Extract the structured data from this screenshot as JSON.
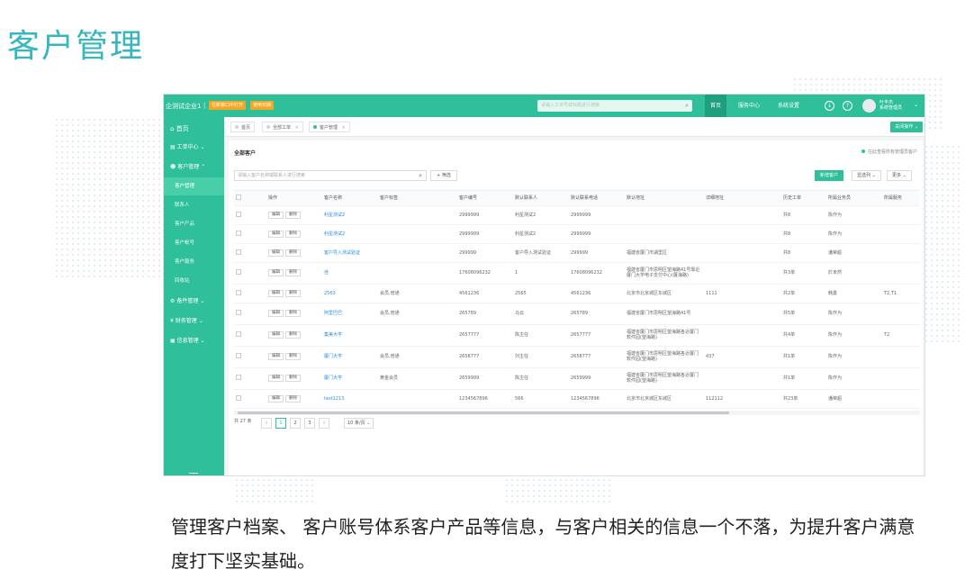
{
  "slide": {
    "title": "客户管理",
    "caption": "管理客户档案、 客户账号体系客户产品等信息，与客户相关的信息一个不落，为提升客户满意度打下坚实基础。"
  },
  "topbar": {
    "company": "企测试企业1",
    "separator": "|",
    "tag1": "在新窗口中打开",
    "tag2": "使用日期",
    "search_placeholder": "请输入工单号或标题进行搜索",
    "nav": [
      "首页",
      "服务中心",
      "系统设置"
    ],
    "active_nav": "首页",
    "user_name": "叶丰杰",
    "user_role": "系统管理员"
  },
  "sidebar": {
    "home": "首页",
    "items": [
      {
        "label": "工单中心",
        "icon": "list-icon"
      },
      {
        "label": "客户管理",
        "icon": "user-icon"
      }
    ],
    "sub_items": [
      "客户管理",
      "联系人",
      "客户产品",
      "客户帐号",
      "客户服务",
      "回收站"
    ],
    "active_sub": "客户管理",
    "more_items": [
      {
        "label": "备件管理",
        "icon": "gear-icon"
      },
      {
        "label": "财务管理",
        "icon": "yen-icon"
      },
      {
        "label": "信息管理",
        "icon": "message-icon"
      }
    ]
  },
  "tabs": [
    {
      "label": "首页",
      "closable": false,
      "active": false
    },
    {
      "label": "全部工单",
      "closable": true,
      "active": false
    },
    {
      "label": "客户管理",
      "closable": true,
      "active": true
    }
  ],
  "close_ops_label": "关闭操作",
  "content": {
    "title": "全部客户",
    "hint": "在此查看所有管理员客户",
    "search_placeholder": "请输入客户名称或联系人进行搜索",
    "filter_label": "+ 筛选",
    "new_button": "新增客户",
    "column_button": "显选列",
    "more_button": "更多"
  },
  "table": {
    "columns": [
      "操作",
      "客户名称",
      "客户标签",
      "客户编号",
      "默认联系人",
      "默认联系电话",
      "默认地址",
      "详细地址",
      "历史工单",
      "所属业务员",
      "所属服务"
    ],
    "edit_label": "编辑",
    "delete_label": "删除",
    "rows": [
      [
        "利星测试2",
        "",
        "2999999",
        "利星测试2",
        "2999999",
        "",
        "",
        "共8",
        "陈作为",
        ""
      ],
      [
        "利星测试2",
        "",
        "2999999",
        "利星测试2",
        "2999999",
        "",
        "",
        "共8",
        "陈作为",
        ""
      ],
      [
        "客户导入测试验证",
        "",
        "299999",
        "客户导入测试验证",
        "299999",
        "福建省厦门市湖里区",
        "",
        "共8",
        "潘荣超",
        ""
      ],
      [
        "佳",
        "",
        "17608096232",
        "1",
        "17608096232",
        "福建省厦门市思明区望海路41号靠近厦门大学电子支付中心(厦海路)",
        "",
        "共3单",
        "於未然",
        ""
      ],
      [
        "2563",
        "会员,普通",
        "4561236",
        "2565",
        "4561236",
        "北京市北京城区东城区",
        "1111",
        "共2单",
        "韩勇",
        "T2,T1"
      ],
      [
        "阿里巴巴",
        "会员,普通",
        "265789",
        "马云",
        "265789",
        "福建省厦门市思明区望海路41号",
        "",
        "共5单",
        "陈作为",
        ""
      ],
      [
        "集美大学",
        "",
        "2657777",
        "陈主任",
        "2657777",
        "福建省厦门市思明区望海路各近厦门软件园(望海路)",
        "",
        "共4单",
        "陈作为",
        "T2"
      ],
      [
        "厦门大学",
        "会员,普通",
        "2658777",
        "刘主任",
        "2658777",
        "福建省厦门市思明区望海路各近厦门软件园(望海路)",
        "437",
        "共1单",
        "陈作为",
        ""
      ],
      [
        "厦门大学",
        "黄金会员",
        "2659999",
        "陈主任",
        "2659999",
        "福建省厦门市思明区望海路各近厦门软件园(望海路)",
        "",
        "共1单",
        "陈作为",
        ""
      ],
      [
        "test1213",
        "",
        "1234567896",
        "566",
        "1234567896",
        "北京市北京城区东城区",
        "112112",
        "共23单",
        "潘荣超",
        ""
      ]
    ]
  },
  "pagination": {
    "total": "共 27 条",
    "pages": [
      "1",
      "2",
      "3"
    ],
    "current": "1",
    "prev": "‹",
    "next": "›",
    "page_size": "10 条/页"
  },
  "colors": {
    "brand": "#2fbf9a",
    "title": "#36b6bd",
    "tag": "#f5a623",
    "link": "#2b8fd9"
  }
}
